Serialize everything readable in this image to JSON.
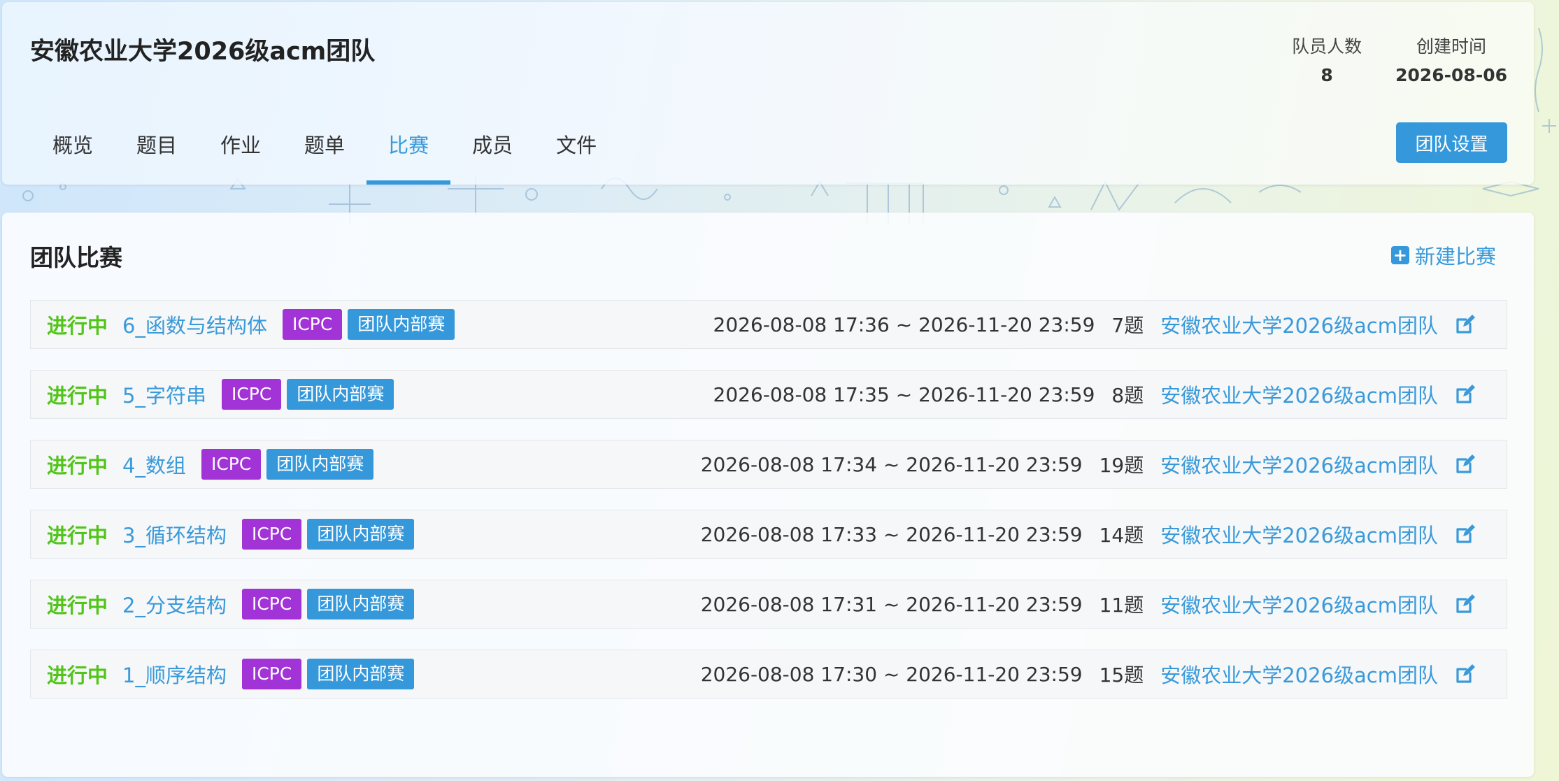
{
  "team": {
    "name": "安徽农业大学2026级acm团队",
    "stats": [
      {
        "label": "队员人数",
        "value": "8"
      },
      {
        "label": "创建时间",
        "value": "2026-08-06"
      }
    ],
    "settings_label": "团队设置"
  },
  "tabs": [
    {
      "label": "概览",
      "active": false
    },
    {
      "label": "题目",
      "active": false
    },
    {
      "label": "作业",
      "active": false
    },
    {
      "label": "题单",
      "active": false
    },
    {
      "label": "比赛",
      "active": true
    },
    {
      "label": "成员",
      "active": false
    },
    {
      "label": "文件",
      "active": false
    }
  ],
  "section": {
    "title": "团队比赛",
    "new_label": "新建比赛"
  },
  "contests": [
    {
      "status": "进行中",
      "title": "6_函数与结构体",
      "rule": "ICPC",
      "kind": "团队内部赛",
      "time": "2026-08-08 17:36 ~ 2026-11-20 23:59",
      "count": "7题",
      "team": "安徽农业大学2026级acm团队"
    },
    {
      "status": "进行中",
      "title": "5_字符串",
      "rule": "ICPC",
      "kind": "团队内部赛",
      "time": "2026-08-08 17:35 ~ 2026-11-20 23:59",
      "count": "8题",
      "team": "安徽农业大学2026级acm团队"
    },
    {
      "status": "进行中",
      "title": "4_数组",
      "rule": "ICPC",
      "kind": "团队内部赛",
      "time": "2026-08-08 17:34 ~ 2026-11-20 23:59",
      "count": "19题",
      "team": "安徽农业大学2026级acm团队"
    },
    {
      "status": "进行中",
      "title": "3_循环结构",
      "rule": "ICPC",
      "kind": "团队内部赛",
      "time": "2026-08-08 17:33 ~ 2026-11-20 23:59",
      "count": "14题",
      "team": "安徽农业大学2026级acm团队"
    },
    {
      "status": "进行中",
      "title": "2_分支结构",
      "rule": "ICPC",
      "kind": "团队内部赛",
      "time": "2026-08-08 17:31 ~ 2026-11-20 23:59",
      "count": "11题",
      "team": "安徽农业大学2026级acm团队"
    },
    {
      "status": "进行中",
      "title": "1_顺序结构",
      "rule": "ICPC",
      "kind": "团队内部赛",
      "time": "2026-08-08 17:30 ~ 2026-11-20 23:59",
      "count": "15题",
      "team": "安徽农业大学2026级acm团队"
    }
  ],
  "colors": {
    "accent": "#3498db",
    "running": "#52c41a",
    "icpc_badge": "#a233d6"
  },
  "icons": {
    "new_contest": "plus-square-icon",
    "edit": "edit-icon"
  }
}
